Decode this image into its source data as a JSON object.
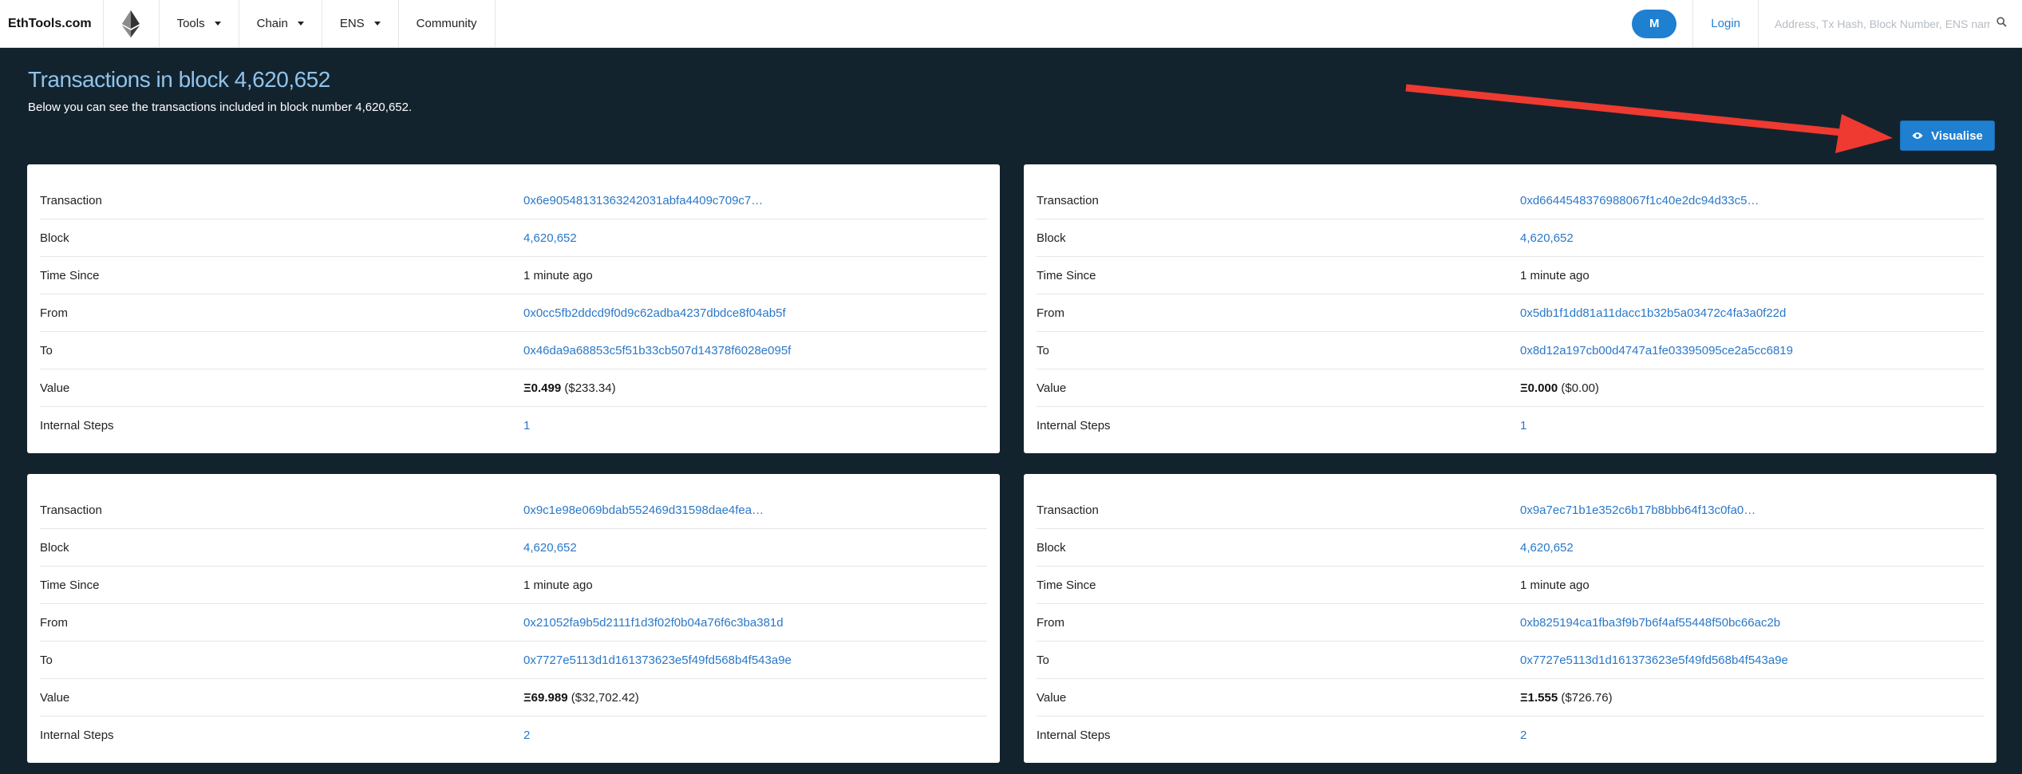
{
  "nav": {
    "brand": "EthTools.com",
    "items": [
      {
        "label": "Tools"
      },
      {
        "label": "Chain"
      },
      {
        "label": "ENS"
      },
      {
        "label": "Community"
      }
    ],
    "metamask_label": "M",
    "login_label": "Login",
    "search_placeholder": "Address, Tx Hash, Block Number, ENS name..."
  },
  "header": {
    "title": "Transactions in block 4,620,652",
    "subtitle": "Below you can see the transactions included in block number 4,620,652.",
    "visualise_label": "Visualise"
  },
  "colors": {
    "background": "#13232e",
    "accent": "#1f7fd1",
    "title": "#8fc3ec",
    "link": "#2a78c9",
    "arrow": "#ee3a30"
  },
  "labels": {
    "transaction": "Transaction",
    "block": "Block",
    "time_since": "Time Since",
    "from": "From",
    "to": "To",
    "value": "Value",
    "internal_steps": "Internal Steps"
  },
  "transactions": [
    {
      "hash": "0x6e90548131363242031abfa4409c709c7…",
      "block": "4,620,652",
      "time_since": "1 minute ago",
      "from": "0x0cc5fb2ddcd9f0d9c62adba4237dbdce8f04ab5f",
      "to": "0x46da9a68853c5f51b33cb507d14378f6028e095f",
      "value_eth": "Ξ0.499",
      "value_usd": "($233.34)",
      "internal_steps": "1"
    },
    {
      "hash": "0xd6644548376988067f1c40e2dc94d33c5…",
      "block": "4,620,652",
      "time_since": "1 minute ago",
      "from": "0x5db1f1dd81a11dacc1b32b5a03472c4fa3a0f22d",
      "to": "0x8d12a197cb00d4747a1fe03395095ce2a5cc6819",
      "value_eth": "Ξ0.000",
      "value_usd": "($0.00)",
      "internal_steps": "1"
    },
    {
      "hash": "0x9c1e98e069bdab552469d31598dae4fea…",
      "block": "4,620,652",
      "time_since": "1 minute ago",
      "from": "0x21052fa9b5d2111f1d3f02f0b04a76f6c3ba381d",
      "to": "0x7727e5113d1d161373623e5f49fd568b4f543a9e",
      "value_eth": "Ξ69.989",
      "value_usd": "($32,702.42)",
      "internal_steps": "2"
    },
    {
      "hash": "0x9a7ec71b1e352c6b17b8bbb64f13c0fa0…",
      "block": "4,620,652",
      "time_since": "1 minute ago",
      "from": "0xb825194ca1fba3f9b7b6f4af55448f50bc66ac2b",
      "to": "0x7727e5113d1d161373623e5f49fd568b4f543a9e",
      "value_eth": "Ξ1.555",
      "value_usd": "($726.76)",
      "internal_steps": "2"
    }
  ]
}
